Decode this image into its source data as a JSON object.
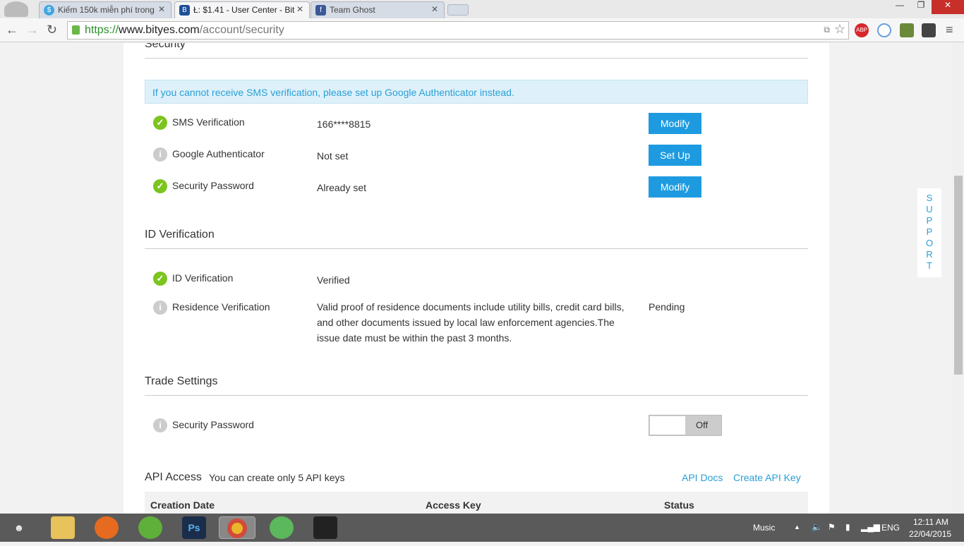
{
  "browser": {
    "tabs": [
      {
        "title": "Kiếm 150k miễn phí trong",
        "icon": "dollar-icon",
        "active": false
      },
      {
        "title": "Ł: $1.41 - User Center - Bit",
        "icon": "bityes-icon",
        "active": true
      },
      {
        "title": "Team Ghost",
        "icon": "facebook-icon",
        "active": false
      }
    ],
    "url": {
      "scheme": "https://",
      "host": "www.bityes.com",
      "path": "/account/security"
    },
    "extensions": [
      "ABP"
    ]
  },
  "security": {
    "title": "Security",
    "notice": "If you cannot receive SMS verification, please set up Google Authenticator instead.",
    "items": [
      {
        "label": "SMS Verification",
        "value": "166****8815",
        "status": "ok",
        "button": "Modify"
      },
      {
        "label": "Google Authenticator",
        "value": "Not set",
        "status": "info",
        "button": "Set Up"
      },
      {
        "label": "Security Password",
        "value": "Already set",
        "status": "ok",
        "button": "Modify"
      }
    ]
  },
  "id_verification": {
    "title": "ID Verification",
    "items": [
      {
        "label": "ID Verification",
        "value": "Verified",
        "status": "ok"
      },
      {
        "label": "Residence Verification",
        "value": "Valid proof of residence documents include utility bills, credit card bills, and other documents issued by local law enforcement agencies.The issue date must be within the past 3 months.",
        "status": "info",
        "state": "Pending"
      }
    ]
  },
  "trade_settings": {
    "title": "Trade Settings",
    "items": [
      {
        "label": "Security Password",
        "toggle": "Off"
      }
    ]
  },
  "api_access": {
    "title": "API Access",
    "subtitle": "You can create only 5 API keys",
    "docs_link": "API Docs",
    "create_link": "Create API Key",
    "columns": [
      "Creation Date",
      "Access Key",
      "Status"
    ]
  },
  "support": "SUPPORT",
  "taskbar": {
    "music": "Music",
    "lang": "ENG",
    "time": "12:11 AM",
    "date": "22/04/2015"
  },
  "colors": {
    "accent": "#1e9be0",
    "ok": "#7cc41f",
    "notice_bg": "#def1fa"
  }
}
